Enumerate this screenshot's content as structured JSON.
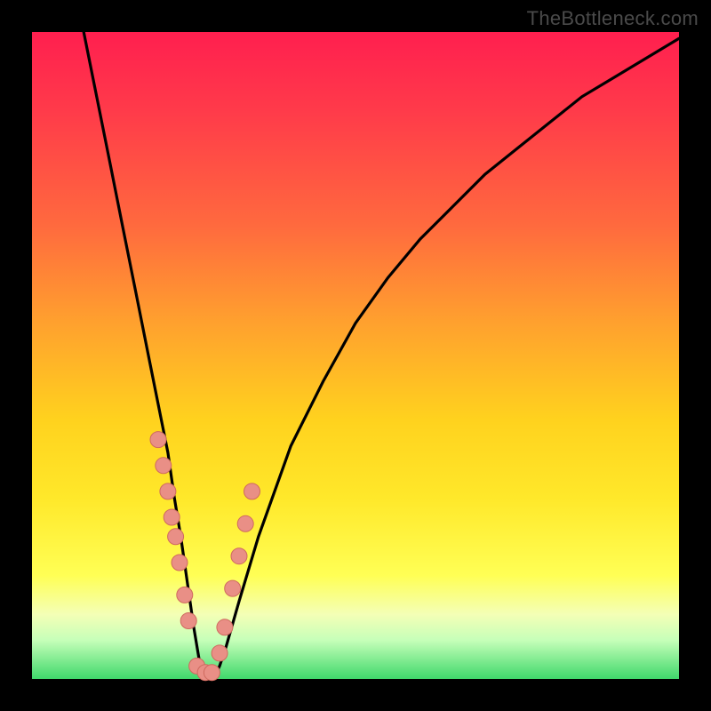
{
  "watermark": "TheBottleneck.com",
  "colors": {
    "curve_stroke": "#000000",
    "marker_fill": "#e98f86",
    "marker_stroke": "#cf6a5f"
  },
  "chart_data": {
    "type": "line",
    "title": "",
    "xlabel": "",
    "ylabel": "",
    "xlim": [
      0,
      100
    ],
    "ylim": [
      0,
      100
    ],
    "series": [
      {
        "name": "bottleneck-curve",
        "x": [
          8,
          10,
          12,
          14,
          16,
          18,
          20,
          21,
          22,
          23,
          24,
          25,
          26,
          27,
          28,
          29,
          30,
          32,
          35,
          40,
          45,
          50,
          55,
          60,
          65,
          70,
          75,
          80,
          85,
          90,
          95,
          100
        ],
        "values": [
          100,
          90,
          80,
          70,
          60,
          50,
          40,
          35,
          28,
          22,
          15,
          8,
          2,
          0,
          0,
          2,
          5,
          12,
          22,
          36,
          46,
          55,
          62,
          68,
          73,
          78,
          82,
          86,
          90,
          93,
          96,
          99
        ]
      }
    ],
    "markers": {
      "name": "highlight-points",
      "x": [
        19.5,
        20.3,
        21.0,
        21.6,
        22.2,
        22.8,
        23.6,
        24.2,
        25.5,
        26.8,
        27.8,
        29.0,
        29.8,
        31.0,
        32.0,
        33.0,
        34.0
      ],
      "values": [
        37,
        33,
        29,
        25,
        22,
        18,
        13,
        9,
        2,
        1,
        1,
        4,
        8,
        14,
        19,
        24,
        29
      ]
    }
  }
}
